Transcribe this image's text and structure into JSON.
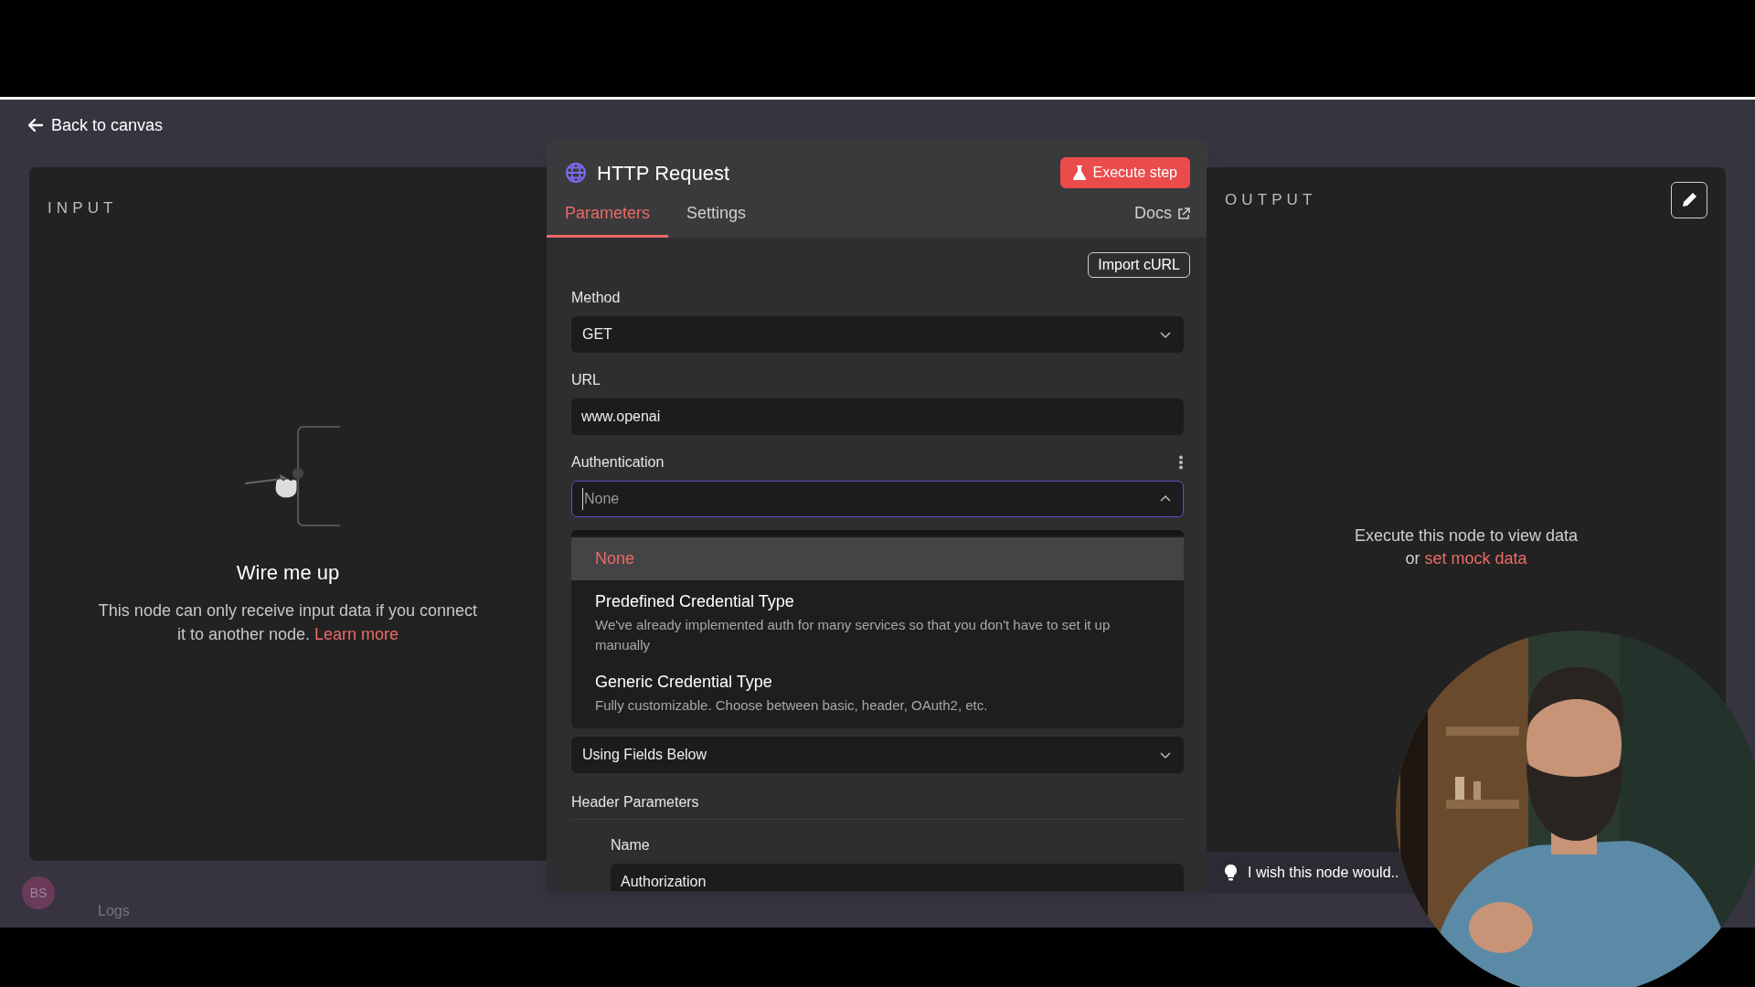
{
  "back_link": "Back to canvas",
  "input_panel": {
    "title": "INPUT",
    "empty_title": "Wire me up",
    "empty_text": "This node can only receive input data if you connect it to another node.",
    "link": "Learn more"
  },
  "user_avatar": "BS",
  "logs": "Logs",
  "node": {
    "title": "HTTP Request",
    "execute_button": "Execute step",
    "tabs": [
      {
        "label": "Parameters",
        "selected": true
      },
      {
        "label": "Settings",
        "selected": false
      }
    ],
    "docs_link": "Docs",
    "import_button": "Import cURL",
    "fields": [
      {
        "kind": "select",
        "label": "Method",
        "value": "GET",
        "expanded": false
      },
      {
        "kind": "input",
        "label": "URL",
        "value": "www.openai"
      },
      {
        "kind": "select",
        "label": "Authentication",
        "placeholder": "None",
        "expanded": true,
        "has_menu": true,
        "options": [
          {
            "label": "None",
            "selected": true
          },
          {
            "label": "Predefined Credential Type",
            "description": "We've already implemented auth for many services so that you don't have to set it up manually",
            "selected": false
          },
          {
            "label": "Generic Credential Type",
            "description": "Fully customizable. Choose between basic, header, OAuth2, etc.",
            "selected": false
          }
        ]
      },
      {
        "kind": "select",
        "value": "Using Fields Below",
        "expanded": false
      }
    ],
    "section": {
      "title": "Header Parameters",
      "fields": [
        {
          "kind": "input",
          "label": "Name",
          "value": "Authorization"
        }
      ]
    }
  },
  "output_panel": {
    "title": "OUTPUT",
    "message_lines": [
      "Execute this node to view data",
      "or"
    ],
    "link": "set mock data",
    "tip": "I wish this node would.."
  }
}
